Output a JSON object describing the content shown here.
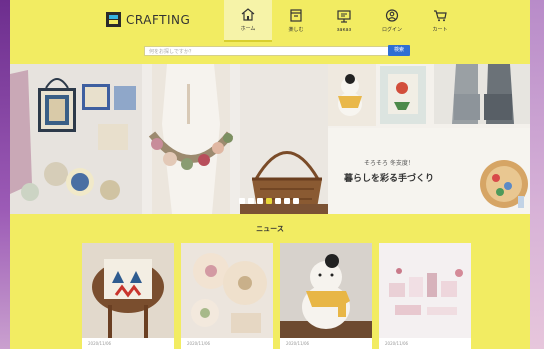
{
  "brand": {
    "name": "CRAFTING"
  },
  "nav": [
    {
      "label": "ホーム",
      "icon": "home-icon",
      "active": true
    },
    {
      "label": "楽しむ",
      "icon": "box-icon",
      "active": false
    },
    {
      "label": "заказ",
      "icon": "monitor-icon",
      "active": false
    },
    {
      "label": "ログイン",
      "icon": "user-icon",
      "active": false
    },
    {
      "label": "カート",
      "icon": "cart-icon",
      "active": false
    }
  ],
  "search": {
    "placeholder": "何をお探しですか？",
    "button": "検索"
  },
  "hero": {
    "tagline": "そろそろ 冬支度！",
    "headline": "暮らしを彩る手づくり",
    "slide_count": 7,
    "active_slide": 4
  },
  "news": {
    "title": "ニュース",
    "items": [
      {
        "date": "2020/11/06"
      },
      {
        "date": "2020/11/06"
      },
      {
        "date": "2020/11/06"
      },
      {
        "date": "2020/11/06"
      }
    ]
  },
  "colors": {
    "accent": "#f2ec62",
    "button": "#2f6fd3"
  }
}
